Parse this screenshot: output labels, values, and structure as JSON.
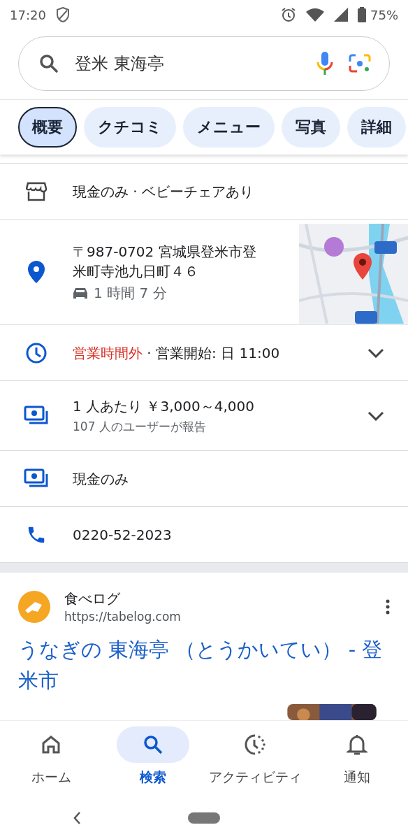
{
  "status_bar": {
    "time": "17:20",
    "battery": "75%"
  },
  "search": {
    "value": "登米 東海亭"
  },
  "tabs": [
    {
      "label": "概要",
      "selected": true
    },
    {
      "label": "クチコミ",
      "selected": false
    },
    {
      "label": "メニュー",
      "selected": false
    },
    {
      "label": "写真",
      "selected": false
    },
    {
      "label": "詳細",
      "selected": false
    }
  ],
  "info_rows": [
    {
      "kind": "amenities",
      "text": "現金のみ · ベビーチェアあり"
    },
    {
      "kind": "address",
      "text": "〒987-0702 宮城県登米市登米町寺池九日町４６",
      "travel_time": "1 時間 7 分"
    },
    {
      "kind": "hours",
      "status": "営業時間外",
      "text": " · 営業開始: 日 11:00",
      "expanded": false
    },
    {
      "kind": "price",
      "text": "1 人あたり ￥3,000～4,000",
      "subtext": "107 人のユーザーが報告",
      "expanded": false
    },
    {
      "kind": "payment",
      "text": "現金のみ"
    },
    {
      "kind": "phone",
      "text": "0220-52-2023"
    }
  ],
  "result": {
    "site_name": "食べログ",
    "url": "https://tabelog.com",
    "title": "うなぎの 東海亭 （とうかいてい） - 登米市"
  },
  "bottom_nav": [
    {
      "label": "ホーム",
      "selected": false
    },
    {
      "label": "検索",
      "selected": true
    },
    {
      "label": "アクティビティ",
      "selected": false
    },
    {
      "label": "通知",
      "selected": false
    }
  ]
}
